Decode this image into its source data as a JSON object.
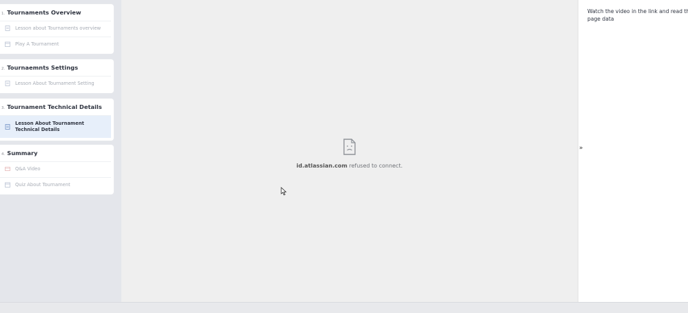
{
  "sections": [
    {
      "number": "1.",
      "title": "Tournaments Overview",
      "items": [
        {
          "label": "Lesson about Tournaments overview",
          "icon": "document-icon"
        },
        {
          "label": "Play A Tournament",
          "icon": "calendar-icon"
        }
      ]
    },
    {
      "number": "2.",
      "title": "Tournaemnts Settings",
      "items": [
        {
          "label": "Lesson About Tournament Setting",
          "icon": "document-icon"
        }
      ]
    },
    {
      "number": "3.",
      "title": "Tournament Technical Details",
      "items": [
        {
          "label": "Lesson About Tournament Technical Details",
          "icon": "document-icon",
          "active": true
        }
      ]
    },
    {
      "number": "4.",
      "title": "Summary",
      "items": [
        {
          "label": "Q&A Video",
          "icon": "video-icon"
        },
        {
          "label": "Quiz About Tournament",
          "icon": "calendar-icon"
        }
      ]
    }
  ],
  "content": {
    "error_icon": "broken-page-icon",
    "error_host": "id.atlassian.com",
    "error_message": " refused to connect."
  },
  "instructions": {
    "text": "Watch the video in the link and read the page data"
  },
  "panel_toggle": "»",
  "colors": {
    "active_item_bg": "#e7effa",
    "content_bg": "#efefef",
    "sidebar_bg": "#e4e6eb"
  }
}
